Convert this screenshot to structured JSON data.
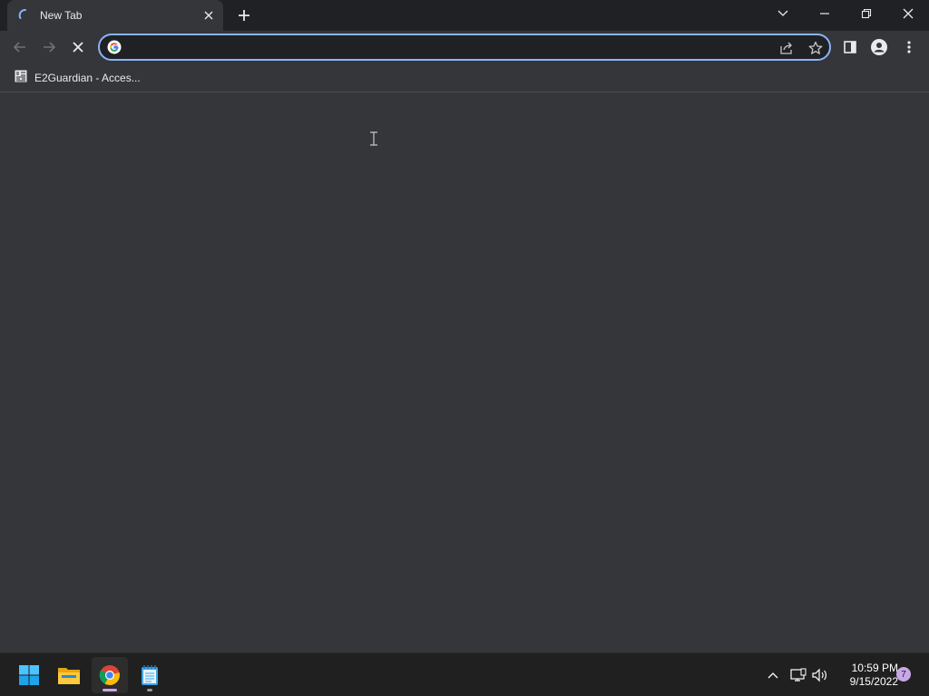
{
  "browser": {
    "tab": {
      "title": "New Tab",
      "loading": true
    },
    "omnibox": {
      "value": "",
      "placeholder": ""
    },
    "bookmarks": [
      {
        "label": "E2Guardian - Acces..."
      }
    ],
    "colors": {
      "accent": "#8ab4f8",
      "chrome_bg": "#202124",
      "surface": "#35363a"
    },
    "icons": {
      "back": "arrow-left-icon",
      "forward": "arrow-right-icon",
      "stop": "close-icon",
      "share": "share-icon",
      "bookmark": "star-icon",
      "side_panel": "side-panel-icon",
      "profile": "profile-icon",
      "menu": "kebab-menu-icon"
    }
  },
  "taskbar": {
    "time": "10:59 PM",
    "date": "9/15/2022",
    "notification_count": "7",
    "apps": [
      "start-icon",
      "file-explorer-icon",
      "chrome-icon",
      "notepad-icon"
    ]
  }
}
